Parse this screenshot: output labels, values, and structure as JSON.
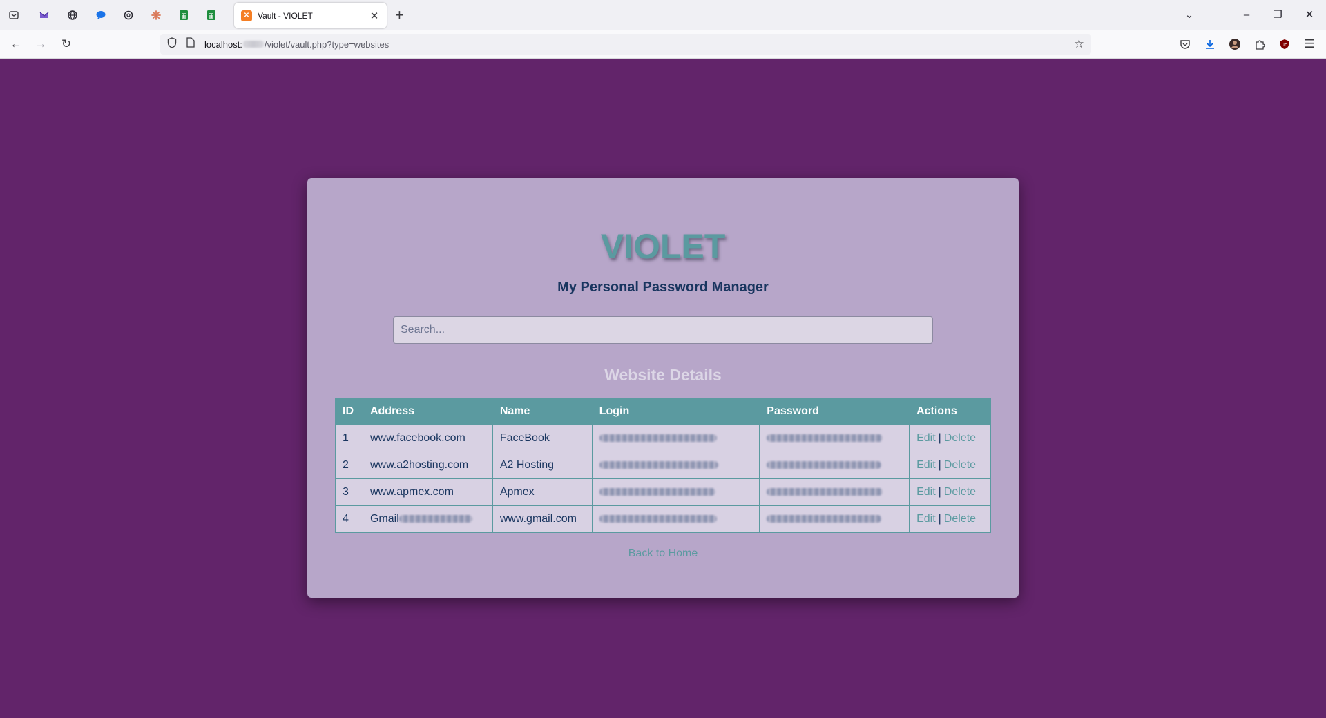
{
  "browser": {
    "tab_title": "Vault - VIOLET",
    "url_host": "localhost:",
    "url_path": "/violet/vault.php?type=websites"
  },
  "page": {
    "brand": "VIOLET",
    "tagline": "My Personal Password Manager",
    "search_placeholder": "Search...",
    "section_title": "Website Details",
    "back_link": "Back to Home"
  },
  "table": {
    "headers": [
      "ID",
      "Address",
      "Name",
      "Login",
      "Password",
      "Actions"
    ],
    "rows": [
      {
        "id": "1",
        "address": "www.facebook.com",
        "name": "FaceBook"
      },
      {
        "id": "2",
        "address": "www.a2hosting.com",
        "name": "A2 Hosting"
      },
      {
        "id": "3",
        "address": "www.apmex.com",
        "name": "Apmex"
      },
      {
        "id": "4",
        "address": "Gmail",
        "name": "www.gmail.com"
      }
    ],
    "edit_label": "Edit",
    "delete_label": "Delete",
    "action_separator": "|"
  },
  "colors": {
    "page_bg": "#62246a",
    "card_bg": "#b7a6c9",
    "accent": "#5b9aa0",
    "text_dark": "#19355f"
  }
}
